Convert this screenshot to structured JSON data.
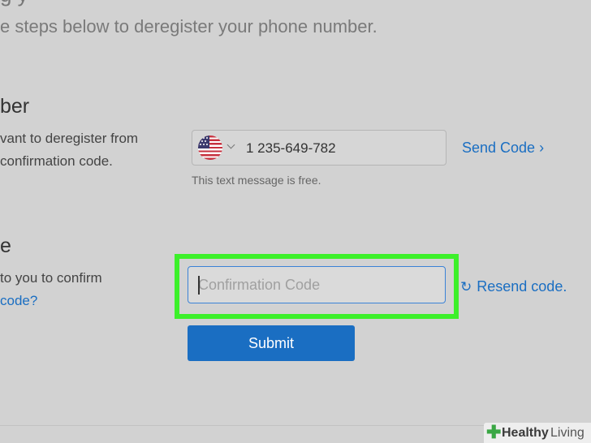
{
  "header": {
    "title_fragment": "g                y",
    "intro_text": "e steps below to deregister your phone number."
  },
  "phone_section": {
    "title": "ber",
    "text_line1": "vant to deregister from",
    "text_line2": "confirmation code.",
    "phone_number": "1 235-649-782",
    "send_code_label": "Send Code ›",
    "note": "This text message is free."
  },
  "code_section": {
    "title": "e",
    "text_line1": "to you to confirm",
    "link_text": "code?",
    "input_placeholder": "Confirmation Code",
    "resend_label": "Resend code.",
    "submit_label": "Submit"
  },
  "watermark": {
    "brand_bold": "Healthy",
    "brand_light": "Living"
  },
  "colors": {
    "accent": "#1a6ec2",
    "highlight": "#3cf02a",
    "background": "#d2d2d2"
  }
}
